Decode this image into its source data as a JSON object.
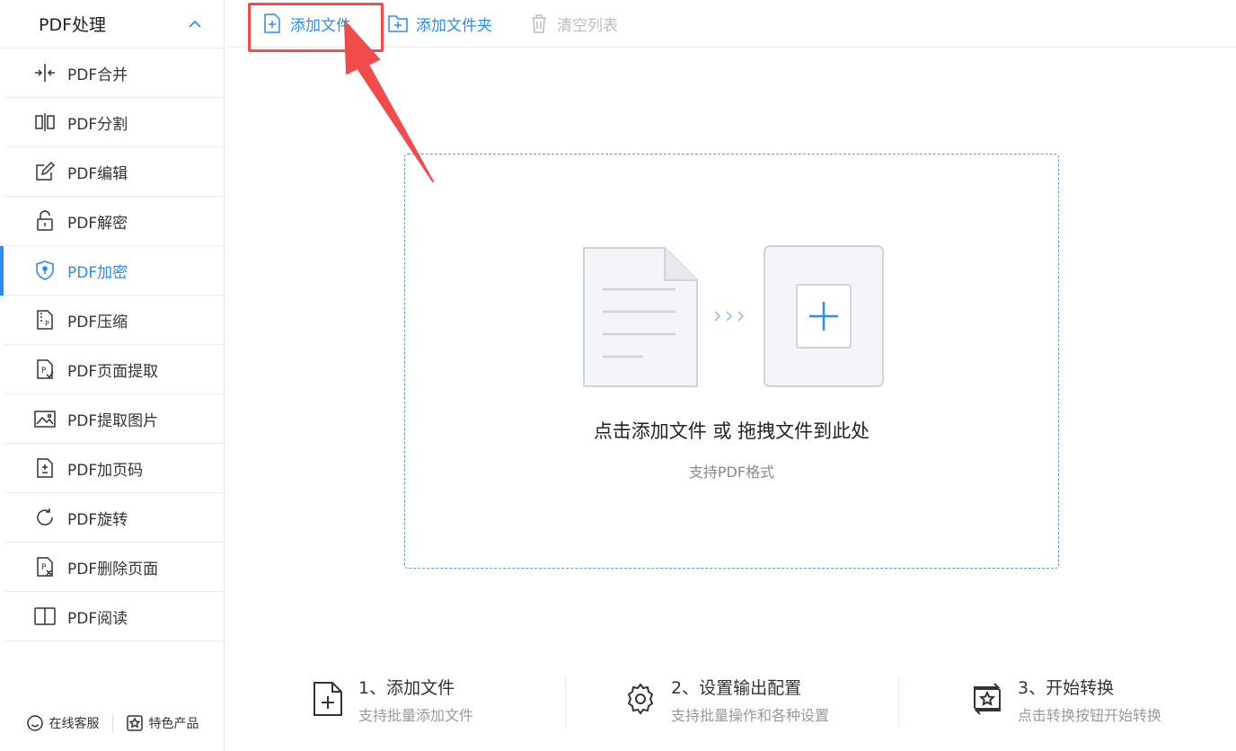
{
  "sidebar": {
    "title": "PDF处理",
    "items": [
      {
        "label": "PDF合并",
        "icon": "merge-icon"
      },
      {
        "label": "PDF分割",
        "icon": "split-icon"
      },
      {
        "label": "PDF编辑",
        "icon": "edit-icon"
      },
      {
        "label": "PDF解密",
        "icon": "unlock-icon"
      },
      {
        "label": "PDF加密",
        "icon": "shield-lock-icon",
        "active": true
      },
      {
        "label": "PDF压缩",
        "icon": "compress-icon"
      },
      {
        "label": "PDF页面提取",
        "icon": "page-extract-icon"
      },
      {
        "label": "PDF提取图片",
        "icon": "image-extract-icon"
      },
      {
        "label": "PDF加页码",
        "icon": "page-number-icon"
      },
      {
        "label": "PDF旋转",
        "icon": "rotate-icon"
      },
      {
        "label": "PDF删除页面",
        "icon": "delete-page-icon"
      },
      {
        "label": "PDF阅读",
        "icon": "book-icon"
      }
    ],
    "footer": {
      "service_label": "在线客服",
      "products_label": "特色产品"
    }
  },
  "toolbar": {
    "add_file_label": "添加文件",
    "add_folder_label": "添加文件夹",
    "clear_list_label": "清空列表"
  },
  "dropzone": {
    "main_text": "点击添加文件 或 拖拽文件到此处",
    "sub_text": "支持PDF格式"
  },
  "steps": [
    {
      "title": "1、添加文件",
      "desc": "支持批量添加文件"
    },
    {
      "title": "2、设置输出配置",
      "desc": "支持批量操作和各种设置"
    },
    {
      "title": "3、开始转换",
      "desc": "点击转换按钮开始转换"
    }
  ],
  "colors": {
    "accent": "#2d8cf0",
    "highlight": "#f24b4b",
    "disabled": "#bdbdbd"
  }
}
